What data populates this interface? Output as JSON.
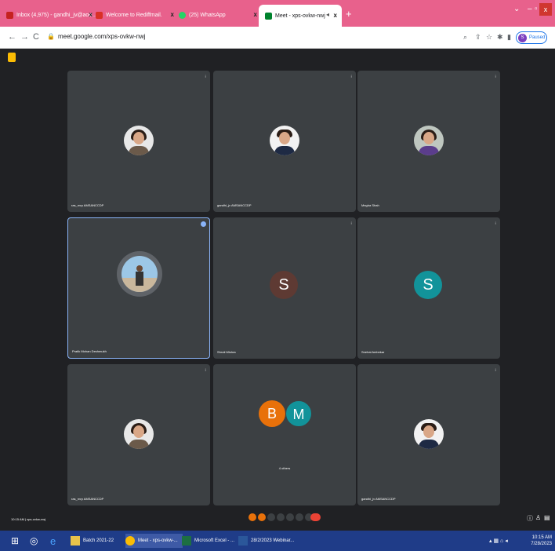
{
  "browser": {
    "tabs": [
      {
        "label": "Inbox (4,975) - gandhi_jv@aoo...",
        "color": "#c5221f"
      },
      {
        "label": "Welcome to Rediffmail.",
        "color": "#d93025"
      },
      {
        "label": "(25) WhatsApp",
        "color": "#25d366"
      },
      {
        "label": "Meet - xps-ovkw-nwj",
        "color": "#00832d"
      }
    ],
    "new_tab": "+",
    "url": "meet.google.com/xps-ovkw-nwj",
    "profile_label": "Paused",
    "profile_initial": "S"
  },
  "tiles": [
    {
      "name": "ras_rnrp AMSANCCDP"
    },
    {
      "name": "gandhi_jv AMSANCCDP"
    },
    {
      "name": "Megha Shah"
    },
    {
      "name": "Pratik Mohan Deshmukh"
    },
    {
      "name": "Shruti Mishra",
      "initial": "S",
      "color": "#5e3a33"
    },
    {
      "name": "Snehal Ambekar",
      "initial": "S",
      "color": "#12939a"
    },
    {
      "name": "ras_rnrp AMSANCCDP"
    },
    {
      "others": "4 others",
      "b": "B",
      "m": "M"
    },
    {
      "name": "gandhi_jv AMSANCCDP"
    }
  ],
  "meet_footer": {
    "left": "10:15 AM | xps-ovkw-nwj"
  },
  "taskbar": {
    "items": [
      "Batch 2021-22",
      "Meet - xps-ovkw-...",
      "Microsoft Excel - ...",
      "28/2/2023 Webinar..."
    ],
    "time": "10:15 AM",
    "date": "7/28/2023"
  }
}
